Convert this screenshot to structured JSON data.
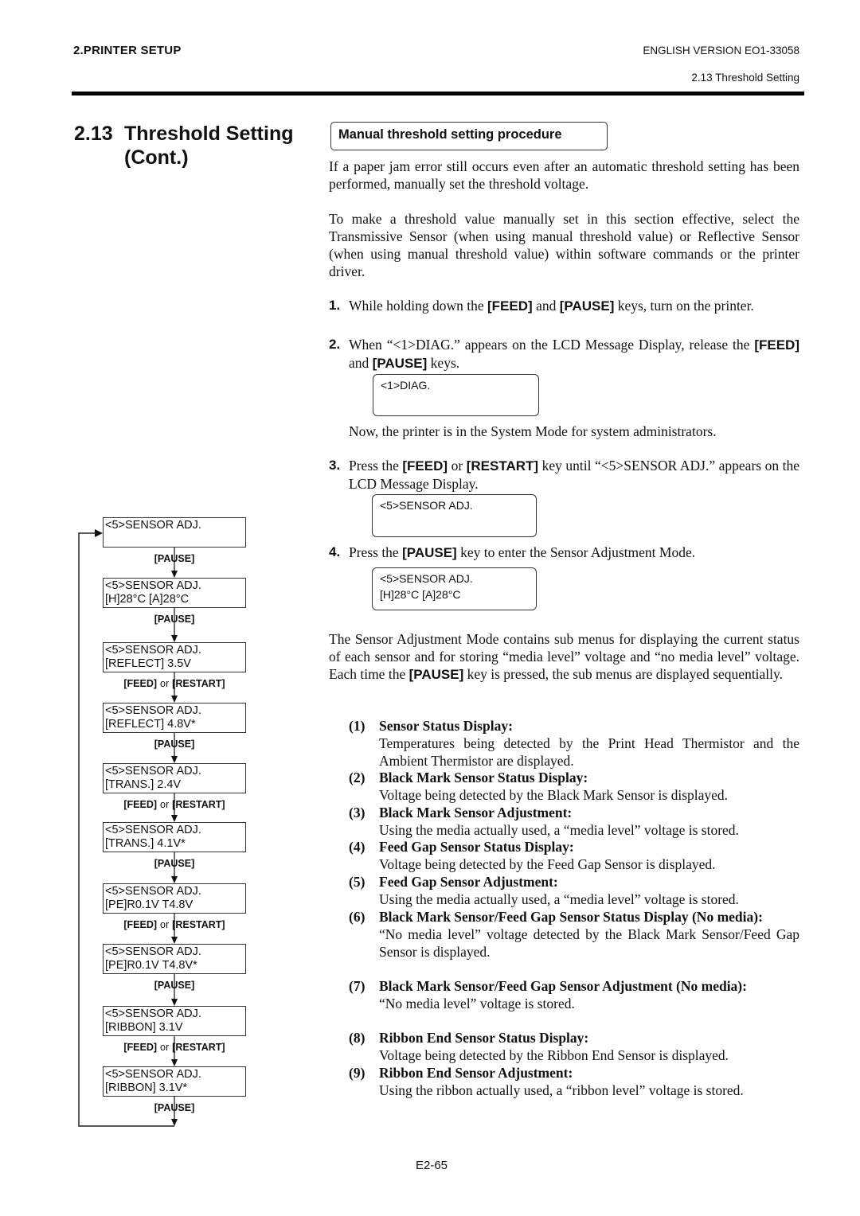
{
  "header": {
    "chapter": "2.PRINTER SETUP",
    "version": "ENGLISH VERSION EO1-33058",
    "section_ref": "2.13 Threshold Setting"
  },
  "section": {
    "number": "2.13",
    "title": "Threshold Setting",
    "cont": "(Cont.)"
  },
  "procedure_title": "Manual threshold setting procedure",
  "intro": [
    "If a paper jam error still occurs even after an automatic threshold setting has been performed, manually set the threshold voltage.",
    "To make a threshold value manually set in this section effective, select the Transmissive Sensor (when using manual threshold value) or Reflective Sensor (when using manual threshold value) within software commands or the printer driver."
  ],
  "keys": {
    "feed": "[FEED]",
    "pause": "[PAUSE]",
    "restart": "[RESTART]"
  },
  "steps": [
    {
      "num": "1.",
      "pre": "While holding down the ",
      "mid1": " and ",
      "post": " keys, turn on the printer."
    },
    {
      "num": "2.",
      "pre": "When “<1>DIAG.” appears on the LCD Message Display, release the ",
      "mid1": " and ",
      "post": " keys."
    },
    {
      "num": "3.",
      "pre": "Press the ",
      "mid1": " or ",
      "post": " key until “<5>SENSOR ADJ.” appears on the LCD Message Display."
    },
    {
      "num": "4.",
      "pre": "Press the ",
      "post": " key to enter the Sensor Adjustment Mode."
    }
  ],
  "lcd": {
    "diag": [
      "<1>DIAG.",
      ""
    ],
    "sensor_adj": [
      "<5>SENSOR ADJ.",
      ""
    ],
    "sensor_temp": [
      "<5>SENSOR ADJ.",
      "[H]28°C  [A]28°C"
    ]
  },
  "system_mode_note": "Now, the printer is in the System Mode for system administrators.",
  "mode_desc": {
    "pre": "The Sensor Adjustment Mode contains sub menus for displaying the current status of each sensor and for storing “media level” voltage and “no media level” voltage.  Each time the ",
    "post": " key is pressed, the sub menus are displayed sequentially."
  },
  "submenus": [
    {
      "num": "(1)",
      "title": "Sensor Status Display:",
      "desc": "Temperatures being detected by the Print Head Thermistor and the Ambient Thermistor are displayed."
    },
    {
      "num": "(2)",
      "title": "Black Mark Sensor Status Display:",
      "desc": "Voltage being detected by the Black Mark Sensor is displayed."
    },
    {
      "num": "(3)",
      "title": "Black Mark Sensor Adjustment:",
      "desc": "Using the media actually used, a “media level” voltage is stored."
    },
    {
      "num": "(4)",
      "title": "Feed Gap Sensor Status Display:",
      "desc": "Voltage being detected by the Feed Gap Sensor is displayed."
    },
    {
      "num": "(5)",
      "title": "Feed Gap Sensor Adjustment:",
      "desc": "Using the media actually used, a “media level” voltage is stored."
    },
    {
      "num": "(6)",
      "title": "Black Mark Sensor/Feed Gap Sensor Status Display (No media):",
      "desc": "“No media level” voltage detected by the Black Mark Sensor/Feed Gap Sensor is displayed."
    },
    {
      "num": "(7)",
      "title": "Black Mark Sensor/Feed Gap Sensor Adjustment (No media):",
      "desc": "“No media level” voltage is stored."
    },
    {
      "num": "(8)",
      "title": "Ribbon End Sensor Status Display:",
      "desc": "Voltage being detected by the Ribbon End Sensor is displayed."
    },
    {
      "num": "(9)",
      "title": "Ribbon End Sensor Adjustment:",
      "desc": "Using the ribbon actually used, a “ribbon level” voltage is stored."
    }
  ],
  "flow": {
    "or_word": "or",
    "boxes": [
      {
        "line1": "<5>SENSOR ADJ.",
        "line2": ""
      },
      {
        "line1": "<5>SENSOR ADJ.",
        "line2": "[H]28°C  [A]28°C"
      },
      {
        "line1": "<5>SENSOR ADJ.",
        "line2": "[REFLECT] 3.5V"
      },
      {
        "line1": "<5>SENSOR ADJ.",
        "line2": "[REFLECT] 4.8V*"
      },
      {
        "line1": "<5>SENSOR ADJ.",
        "line2": "[TRANS.] 2.4V"
      },
      {
        "line1": "<5>SENSOR ADJ.",
        "line2": "[TRANS.] 4.1V*"
      },
      {
        "line1": "<5>SENSOR ADJ.",
        "line2": "[PE]R0.1V T4.8V"
      },
      {
        "line1": "<5>SENSOR ADJ.",
        "line2": "[PE]R0.1V T4.8V*"
      },
      {
        "line1": "<5>SENSOR ADJ.",
        "line2": "[RIBBON]  3.1V"
      },
      {
        "line1": "<5>SENSOR ADJ.",
        "line2": "[RIBBON]  3.1V*"
      }
    ],
    "transitions": [
      "pause",
      "pause",
      "feed_or_restart",
      "pause",
      "feed_or_restart",
      "pause",
      "feed_or_restart",
      "pause",
      "feed_or_restart",
      "pause"
    ]
  },
  "footer": {
    "page": "E2-65"
  }
}
